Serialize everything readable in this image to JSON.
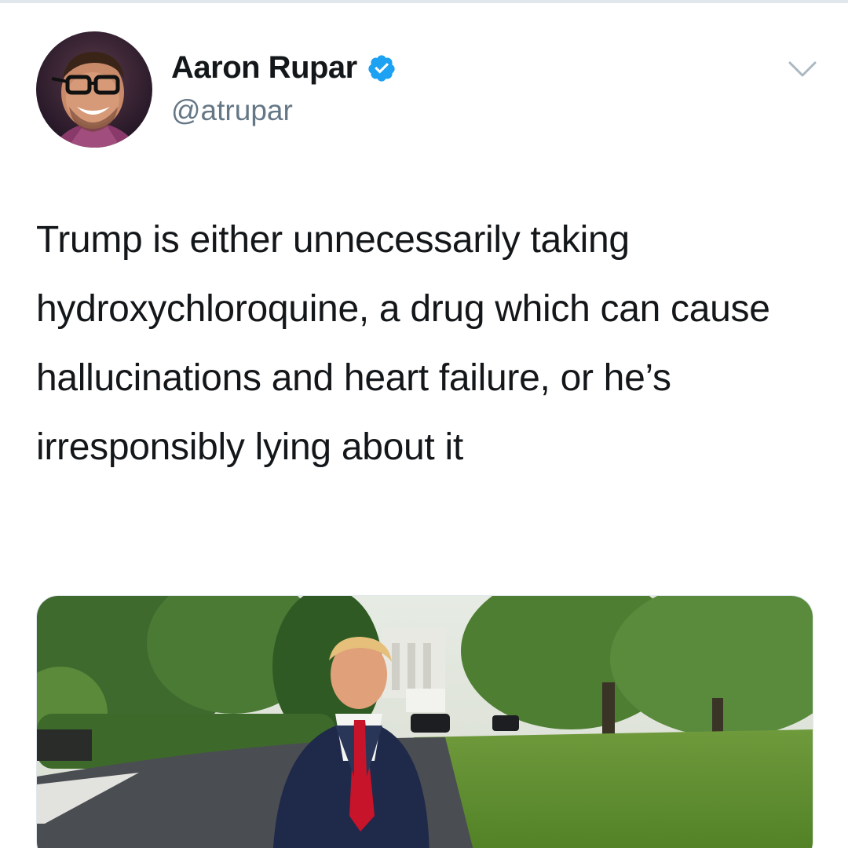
{
  "tweet": {
    "author": {
      "display_name": "Aaron Rupar",
      "handle": "@atrupar",
      "verified": true,
      "avatar_icon": "avatar-photo"
    },
    "menu_icon": "chevron-down-icon",
    "text": "Trump is either unnecessarily taking hydroxychloroquine, a drug which can cause hallucinations and heart failure, or he’s irresponsibly lying about it",
    "media": {
      "kind": "photo",
      "description_icon": "photo-man-in-suit-on-lawn"
    }
  },
  "colors": {
    "verified_blue": "#1da1f2",
    "text_primary": "#14171a",
    "text_secondary": "#657786",
    "divider": "#e1e8ed"
  }
}
